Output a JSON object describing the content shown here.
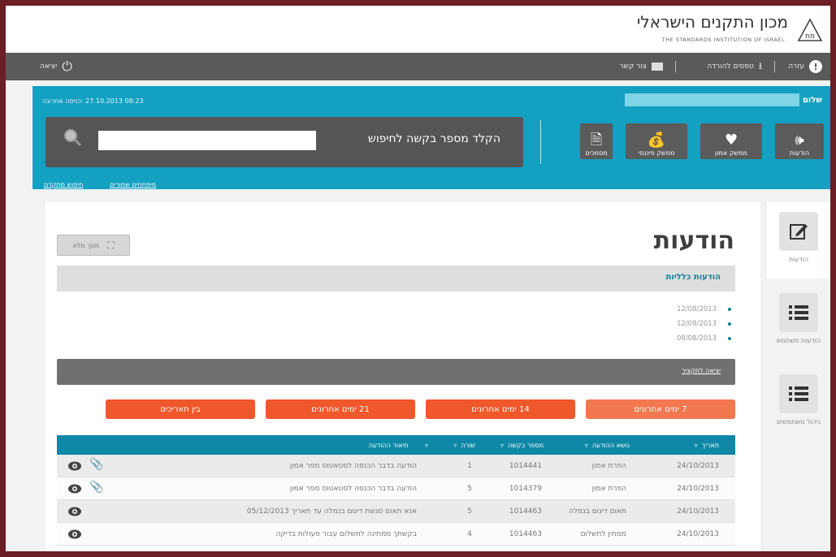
{
  "header": {
    "logo_he": "מכון התקנים הישראלי",
    "logo_en": "THE STANDARDS INSTITUTION OF ISRAEL",
    "logo_mark": "מת"
  },
  "topbar": {
    "help": "עזרה",
    "forms": "טפסים להורדה",
    "contact": "צור קשר",
    "logout": "יציאה"
  },
  "band": {
    "greeting": "שלום",
    "last_login": "08:23 27.10.2013 :כניסה אחרונה",
    "quick": [
      {
        "label": "הודעות",
        "icon": "megaphone-icon"
      },
      {
        "label": "ממשק אמון",
        "icon": "heart-icon"
      },
      {
        "label": "ממשק פיננסי",
        "icon": "money-bag-icon"
      },
      {
        "label": "מסמכים",
        "icon": "document-icon"
      }
    ],
    "search_label": "הקלד מספר בקשה לחיפוש",
    "search_value": "",
    "links": [
      "מיפתחים שמורים",
      "חיפוש מתקדם"
    ]
  },
  "sidetabs": [
    "הודעות",
    "הודעות משתמש",
    "ניהול משתמשים"
  ],
  "main": {
    "fullscreen": "מסך מלא",
    "title": "הודעות",
    "general_title": "הודעות כלליות",
    "general_items": [
      "12/08/2013",
      "12/08/2013",
      "08/08/2013"
    ],
    "dark_link": "יציאה לתקציר",
    "filters": [
      "7 ימים אחרונים",
      "14 ימים אחרונים",
      "21 ימים אחרונים",
      "בין תאריכים"
    ],
    "columns": [
      "תאריך",
      "נושא ההודעה",
      "מספר בקשה",
      "שורה",
      "תיאור ההודעה"
    ],
    "rows": [
      {
        "date": "24/10/2013",
        "subject": "הפרת אמון",
        "req": "1014441",
        "line": "1",
        "desc": "הודעה בדבר הכנסה לסטאטוס מפר אמון",
        "clip": true
      },
      {
        "date": "24/10/2013",
        "subject": "הפרת אמון",
        "req": "1014379",
        "line": "5",
        "desc": "הודעה בדבר הכנסה לסטאטוס מפר אמון",
        "clip": true
      },
      {
        "date": "24/10/2013",
        "subject": "תאום דיגום בנמלה",
        "req": "1014463",
        "line": "5",
        "desc": "אנא תאום סגשת דיגום בנמלה עד תאריך 05/12/2013",
        "clip": false
      },
      {
        "date": "24/10/2013",
        "subject": "ממתין לתשלום",
        "req": "1014463",
        "line": "4",
        "desc": "בקשתך ממתינה לתשלום עבור פעולות בדיקה",
        "clip": false
      }
    ]
  },
  "colors": {
    "accent": "#13a0c1",
    "orange": "#f0572a",
    "orange_light": "#f3774f",
    "table_head": "#0f88a7"
  }
}
